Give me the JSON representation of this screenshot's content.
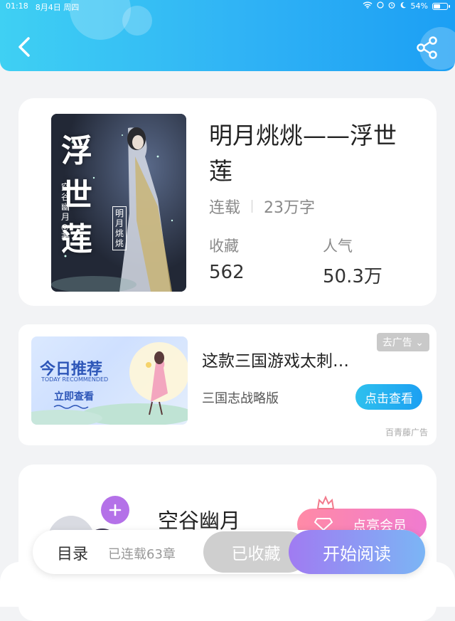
{
  "status_bar": {
    "time": "01:18",
    "date": "8月4日 周四",
    "battery": "54%",
    "battery_level": 0.54
  },
  "header": {
    "back_icon": "chevron-left-icon",
    "share_icon": "share-icon"
  },
  "book": {
    "title": "明月烑烑——浮世莲",
    "status": "连载",
    "word_count": "23万字",
    "stats": [
      {
        "label": "收藏",
        "value": "562"
      },
      {
        "label": "人气",
        "value": "50.3万"
      }
    ],
    "cover": {
      "title_text": "浮世莲",
      "author_text": "空谷幽月◎著",
      "series_text": "明月烑烑"
    }
  },
  "ad": {
    "badge": "去广告",
    "title": "这款三国游戏太刺…",
    "subtitle": "三国志战略版",
    "button": "点击查看",
    "source": "百青藤广告",
    "image": {
      "headline": "今日推荐",
      "subheadline": "TODAY RECOMMENDED",
      "cta": "立即查看"
    }
  },
  "author": {
    "name": "空谷幽月",
    "vip_button": "点亮会员",
    "follow_icon": "plus-icon"
  },
  "bottom_bar": {
    "toc": "目录",
    "chapters": "已连载63章",
    "collected": "已收藏",
    "read": "开始阅读"
  },
  "colors": {
    "header_gradient_start": "#3fd0f3",
    "header_gradient_end": "#1c9ff4",
    "read_button": "#a07bf2",
    "vip_button": "#ff8aa6",
    "ad_button": "#1ca0f2"
  }
}
